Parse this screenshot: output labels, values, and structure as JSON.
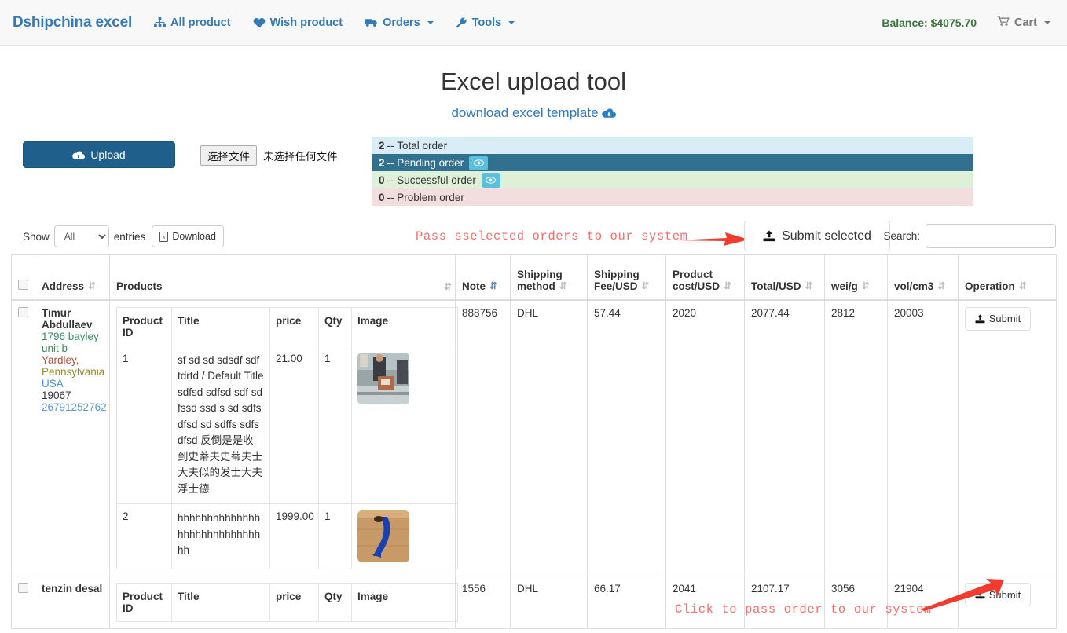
{
  "navbar": {
    "brand": "Dshipchina excel",
    "items": [
      {
        "label": "All product",
        "icon": "sitemap-icon",
        "caret": false
      },
      {
        "label": "Wish product",
        "icon": "heart-icon",
        "caret": false
      },
      {
        "label": "Orders",
        "icon": "truck-icon",
        "caret": true
      },
      {
        "label": "Tools",
        "icon": "wrench-icon",
        "caret": true
      }
    ],
    "balance": "Balance: $4075.70",
    "cart": "Cart"
  },
  "page": {
    "title": "Excel upload tool",
    "download_template": "download excel template",
    "download_template_icon": "cloud-download-icon"
  },
  "upload": {
    "button_label": "Upload",
    "button_icon": "cloud-upload-icon",
    "file_button_label": "选择文件",
    "file_name_label": "未选择任何文件"
  },
  "status_bars": [
    {
      "count": "2",
      "sep": "--",
      "label": "Total order",
      "eye": false,
      "type": "total"
    },
    {
      "count": "2",
      "sep": "--",
      "label": "Pending order",
      "eye": true,
      "type": "pending"
    },
    {
      "count": "0",
      "sep": "--",
      "label": "Successful order",
      "eye": true,
      "type": "success"
    },
    {
      "count": "0",
      "sep": "--",
      "label": "Problem order",
      "eye": false,
      "type": "problem"
    }
  ],
  "controls": {
    "show_label": "Show",
    "entries_label": "entries",
    "page_length_value": "All",
    "page_length_options": [
      "All"
    ],
    "download_label": "Download",
    "download_icon": "excel-icon",
    "submit_selected_label": "Submit selected",
    "submit_selected_icon": "upload-icon",
    "search_label": "Search:",
    "search_value": "",
    "search_placeholder": ""
  },
  "annotations": {
    "pass_selected": "Pass sselected orders to our system",
    "click_to_pass": "Click to pass order to our system",
    "color": "#fb6b6b"
  },
  "table": {
    "columns": [
      {
        "label": "",
        "sort": "none",
        "key": "checkbox"
      },
      {
        "label": "Address",
        "sort": "both",
        "key": "address"
      },
      {
        "label": "Products",
        "sort": "both",
        "key": "products"
      },
      {
        "label": "Note",
        "sort": "desc",
        "key": "note"
      },
      {
        "label": "Shipping method",
        "sort": "both",
        "key": "shipping_method"
      },
      {
        "label": "Shipping Fee/USD",
        "sort": "both",
        "key": "shipping_fee"
      },
      {
        "label": "Product cost/USD",
        "sort": "both",
        "key": "product_cost"
      },
      {
        "label": "Total/USD",
        "sort": "both",
        "key": "total"
      },
      {
        "label": "wei/g",
        "sort": "both",
        "key": "weight"
      },
      {
        "label": "vol/cm3",
        "sort": "both",
        "key": "volume"
      },
      {
        "label": "Operation",
        "sort": "both",
        "key": "operation"
      }
    ],
    "sub_columns": [
      "Product ID",
      "Title",
      "price",
      "Qty",
      "Image"
    ],
    "rows": [
      {
        "address": {
          "name": "Timur Abdullaev",
          "street": "1796 bayley unit b",
          "city": "Yardley",
          "region": ", Pennsylvania",
          "country": "USA",
          "zip": "19067",
          "phone": "26791252762"
        },
        "products": [
          {
            "id": "1",
            "title": "sf sd sd sdsdf sdf tdrtd / Default Title sdfsd sdfsd sdf sd fssd ssd s sd sdfs dfsd sd sdffs sdfs dfsd 反倒是是收到史蒂夫史蒂夫士大夫似的发士大夫浮士德",
            "price": "21.00",
            "qty": "1",
            "image": "warehouse-photo"
          },
          {
            "id": "2",
            "title": "hhhhhhhhhhhhhhhhhhhhhhhhhhhhhh",
            "price": "1999.00",
            "qty": "1",
            "image": "blue-hook-photo"
          }
        ],
        "note": "888756",
        "shipping_method": "DHL",
        "shipping_fee": "57.44",
        "product_cost": "2020",
        "total": "2077.44",
        "weight": "2812",
        "volume": "20003",
        "operation_label": "Submit"
      },
      {
        "address": {
          "name": "tenzin desal",
          "street": "",
          "city": "",
          "region": "",
          "country": "",
          "zip": "",
          "phone": ""
        },
        "products": [],
        "note": "1556",
        "shipping_method": "DHL",
        "shipping_fee": "66.17",
        "product_cost": "2041",
        "total": "2107.17",
        "weight": "3056",
        "volume": "21904",
        "operation_label": "Submit"
      }
    ]
  }
}
